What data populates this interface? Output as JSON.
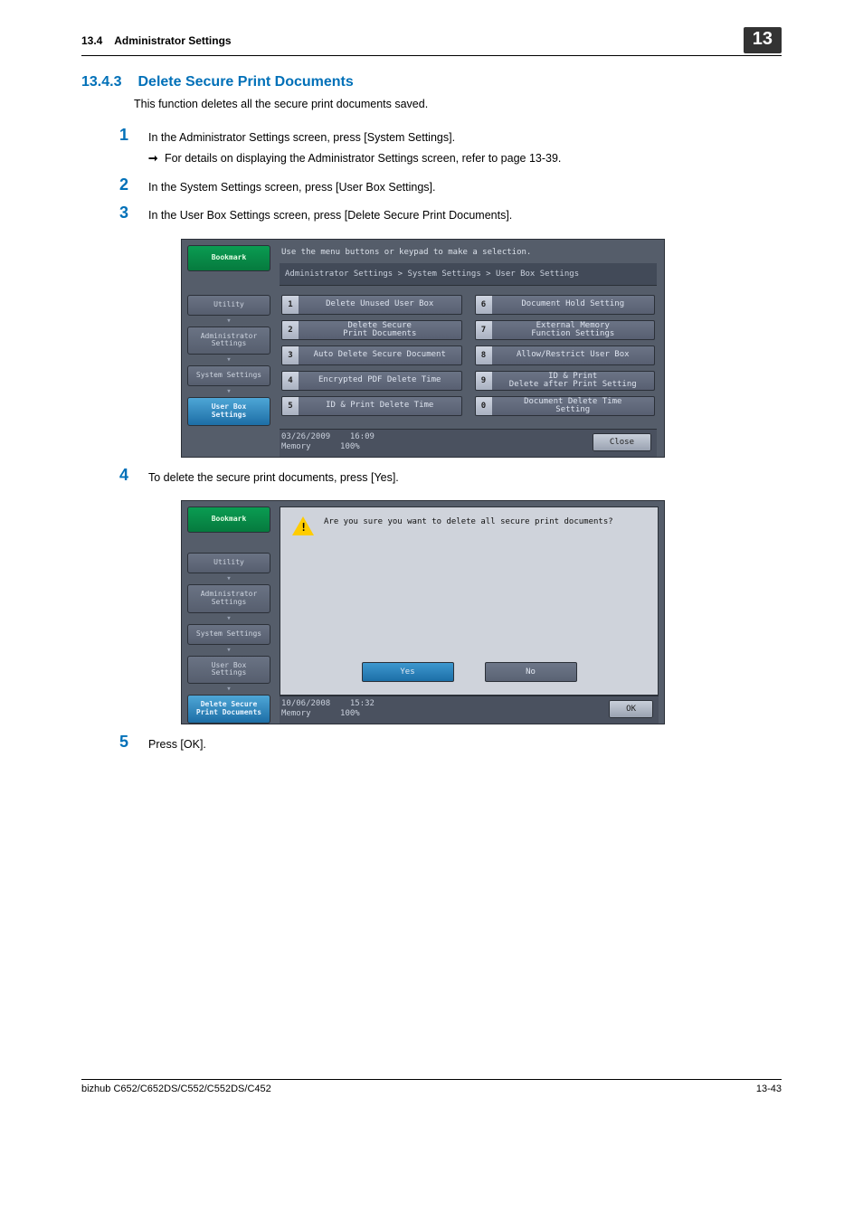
{
  "header": {
    "section_ref": "13.4",
    "section_name": "Administrator Settings",
    "chapter": "13"
  },
  "title": {
    "num": "13.4.3",
    "text": "Delete Secure Print Documents"
  },
  "intro": "This function deletes all the secure print documents saved.",
  "steps": {
    "s1": {
      "num": "1",
      "text": "In the Administrator Settings screen, press [System Settings].",
      "sub": "For details on displaying the Administrator Settings screen, refer to page 13-39."
    },
    "s2": {
      "num": "2",
      "text": "In the System Settings screen, press [User Box Settings]."
    },
    "s3": {
      "num": "3",
      "text": "In the User Box Settings screen, press [Delete Secure Print Documents]."
    },
    "s4": {
      "num": "4",
      "text": "To delete the secure print documents, press [Yes]."
    },
    "s5": {
      "num": "5",
      "text": "Press [OK]."
    }
  },
  "panel1": {
    "top_text": "Use the menu buttons or keypad to make a selection.",
    "breadcrumb": "Administrator Settings > System Settings > User Box Settings",
    "sidebar": {
      "bookmark": "Bookmark",
      "utility": "Utility",
      "admin": "Administrator\nSettings",
      "system": "System Settings",
      "userbox": "User Box\nSettings"
    },
    "items": [
      {
        "n": "1",
        "l": "Delete Unused User Box"
      },
      {
        "n": "2",
        "l": "Delete Secure\nPrint Documents"
      },
      {
        "n": "3",
        "l": "Auto Delete Secure Document"
      },
      {
        "n": "4",
        "l": "Encrypted PDF Delete Time"
      },
      {
        "n": "5",
        "l": "ID & Print Delete Time"
      },
      {
        "n": "6",
        "l": "Document Hold Setting"
      },
      {
        "n": "7",
        "l": "External Memory\nFunction Settings"
      },
      {
        "n": "8",
        "l": "Allow/Restrict User Box"
      },
      {
        "n": "9",
        "l": "ID & Print\nDelete after Print Setting"
      },
      {
        "n": "0",
        "l": "Document Delete Time\nSetting"
      }
    ],
    "status": {
      "date": "03/26/2009",
      "time": "16:09",
      "mem_label": "Memory",
      "mem_val": "100%",
      "close": "Close"
    }
  },
  "panel2": {
    "question": "Are you sure you want to delete all secure print documents?",
    "sidebar": {
      "bookmark": "Bookmark",
      "utility": "Utility",
      "admin": "Administrator\nSettings",
      "system": "System Settings",
      "userbox": "User Box\nSettings",
      "delete": "Delete Secure\nPrint Documents"
    },
    "yes": "Yes",
    "no": "No",
    "status": {
      "date": "10/06/2008",
      "time": "15:32",
      "mem_label": "Memory",
      "mem_val": "100%",
      "ok": "OK"
    }
  },
  "footer": {
    "left": "bizhub C652/C652DS/C552/C552DS/C452",
    "right": "13-43"
  }
}
